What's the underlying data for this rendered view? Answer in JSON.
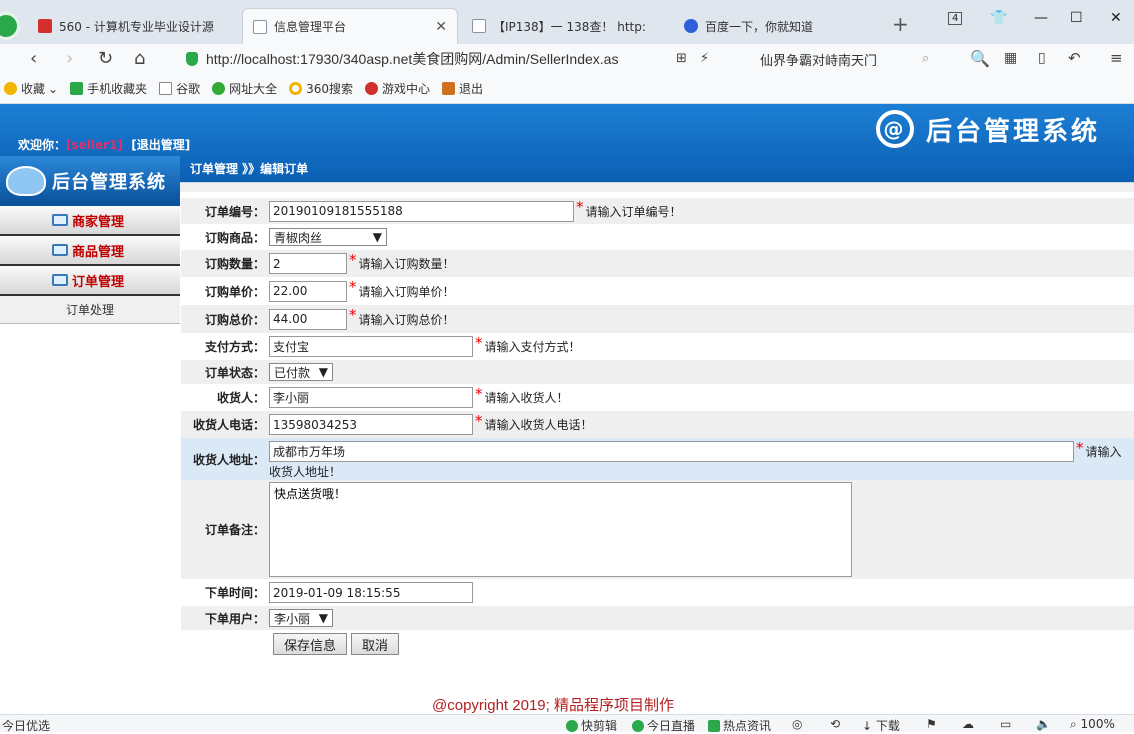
{
  "browser": {
    "tabs": [
      {
        "title": "560 - 计算机专业毕业设计源",
        "color": "#d32f2f"
      },
      {
        "title": "信息管理平台",
        "color": "#8a94a0"
      },
      {
        "title": "【IP138】一 138查！ http:",
        "color": "#8a94a0"
      },
      {
        "title": "百度一下，你就知道",
        "color": "#2e5fd8"
      }
    ],
    "tab_count_badge": "4",
    "url": "http://localhost:17930/340asp.net美食团购网/Admin/SellerIndex.as",
    "search_text": "仙界争霸对峙南天门",
    "bookmarks": [
      "收藏",
      "手机收藏夹",
      "谷歌",
      "网址大全",
      "360搜索",
      "游戏中心",
      "退出"
    ],
    "bookmark_colors": [
      "#f1b400",
      "#2aa84a",
      "#888888",
      "#333333",
      "#f1b400",
      "#d0312d",
      "#d07020"
    ]
  },
  "header": {
    "welcome_prefix": "欢迎你：",
    "username": "[seller1]",
    "logout": "[退出管理]",
    "system_title": "后台管理系统",
    "breadcrumb": "订单管理 》》编辑订单"
  },
  "sidebar": {
    "logo_title": "后台管理系统",
    "items": [
      {
        "label": "商家管理"
      },
      {
        "label": "商品管理"
      },
      {
        "label": "订单管理"
      }
    ],
    "sub_item": "订单处理"
  },
  "form": {
    "order_no": {
      "label": "订单编号：",
      "value": "20190109181555188",
      "hint": "请输入订单编号！"
    },
    "product": {
      "label": "订购商品：",
      "value": "青椒肉丝"
    },
    "quantity": {
      "label": "订购数量：",
      "value": "2",
      "hint": "请输入订购数量！"
    },
    "unit_price": {
      "label": "订购单价：",
      "value": "22.00",
      "hint": "请输入订购单价！"
    },
    "total_price": {
      "label": "订购总价：",
      "value": "44.00",
      "hint": "请输入订购总价！"
    },
    "payment": {
      "label": "支付方式：",
      "value": "支付宝",
      "hint": "请输入支付方式！"
    },
    "status": {
      "label": "订单状态：",
      "value": "已付款"
    },
    "receiver": {
      "label": "收货人：",
      "value": "李小丽",
      "hint": "请输入收货人！"
    },
    "phone": {
      "label": "收货人电话：",
      "value": "13598034253",
      "hint": "请输入收货人电话！"
    },
    "address": {
      "label": "收货人地址：",
      "value": "成都市万年场",
      "hint_a": "请输入",
      "hint_b": "收货人地址！"
    },
    "remark": {
      "label": "订单备注：",
      "value": "快点送货哦！"
    },
    "order_time": {
      "label": "下单时间：",
      "value": "2019-01-09 18:15:55"
    },
    "order_user": {
      "label": "下单用户：",
      "value": "李小丽"
    },
    "save_button": "保存信息",
    "cancel_button": "取消"
  },
  "copyright": "@copyright 2019; 精品程序项目制作",
  "statusbar": {
    "left": "今日优选",
    "items": [
      "快剪辑",
      "今日直播",
      "热点资讯",
      "下载",
      "100%"
    ]
  }
}
